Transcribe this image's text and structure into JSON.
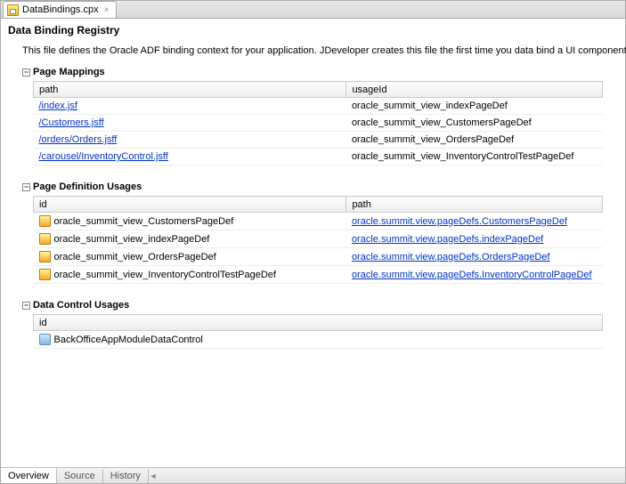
{
  "fileTab": {
    "name": "DataBindings.cpx"
  },
  "title": "Data Binding Registry",
  "description": "This file defines the Oracle ADF binding context for your application. JDeveloper creates this file the first time you data bind a UI component.",
  "pageMappings": {
    "heading": "Page Mappings",
    "columns": {
      "col1": "path",
      "col2": "usageId"
    },
    "rows": [
      {
        "path": "/index.jsf",
        "usageId": "oracle_summit_view_indexPageDef"
      },
      {
        "path": "/Customers.jsff",
        "usageId": "oracle_summit_view_CustomersPageDef"
      },
      {
        "path": "/orders/Orders.jsff",
        "usageId": "oracle_summit_view_OrdersPageDef"
      },
      {
        "path": "/carousel/InventoryControl.jsff",
        "usageId": "oracle_summit_view_InventoryControlTestPageDef"
      }
    ]
  },
  "pageDefUsages": {
    "heading": "Page Definition Usages",
    "columns": {
      "col1": "id",
      "col2": "path"
    },
    "rows": [
      {
        "id": "oracle_summit_view_CustomersPageDef",
        "path": "oracle.summit.view.pageDefs.CustomersPageDef"
      },
      {
        "id": "oracle_summit_view_indexPageDef",
        "path": "oracle.summit.view.pageDefs.indexPageDef"
      },
      {
        "id": "oracle_summit_view_OrdersPageDef",
        "path": "oracle.summit.view.pageDefs.OrdersPageDef"
      },
      {
        "id": "oracle_summit_view_InventoryControlTestPageDef",
        "path": "oracle.summit.view.pageDefs.InventoryControlPageDef"
      }
    ]
  },
  "dataControlUsages": {
    "heading": "Data Control Usages",
    "columns": {
      "col1": "id"
    },
    "rows": [
      {
        "id": "BackOfficeAppModuleDataControl"
      }
    ]
  },
  "bottomTabs": {
    "overview": "Overview",
    "source": "Source",
    "history": "History"
  }
}
